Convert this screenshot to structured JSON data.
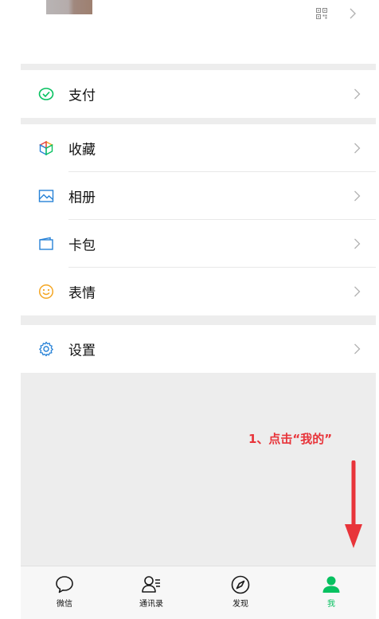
{
  "header": {
    "qr_icon": "qrcode-icon",
    "chevron_icon": "chevron-right-icon"
  },
  "menu": {
    "pay": {
      "label": "支付",
      "icon": "pay-icon",
      "color": "#07c160"
    },
    "favorites": {
      "label": "收藏",
      "icon": "cube-icon"
    },
    "album": {
      "label": "相册",
      "icon": "image-icon",
      "color": "#2782d7"
    },
    "cards": {
      "label": "卡包",
      "icon": "wallet-icon",
      "color": "#2782d7"
    },
    "stickers": {
      "label": "表情",
      "icon": "smile-icon",
      "color": "#f5a623"
    },
    "settings": {
      "label": "设置",
      "icon": "gear-icon",
      "color": "#2782d7"
    }
  },
  "annotation": {
    "text": "1、点击“我的”",
    "color": "#e8343a"
  },
  "tabbar": {
    "tabs": [
      {
        "label": "微信",
        "icon": "chat-bubble-icon"
      },
      {
        "label": "通讯录",
        "icon": "contacts-icon"
      },
      {
        "label": "发现",
        "icon": "compass-icon"
      },
      {
        "label": "我",
        "icon": "person-icon",
        "active": true
      }
    ],
    "active_color": "#07c160"
  }
}
